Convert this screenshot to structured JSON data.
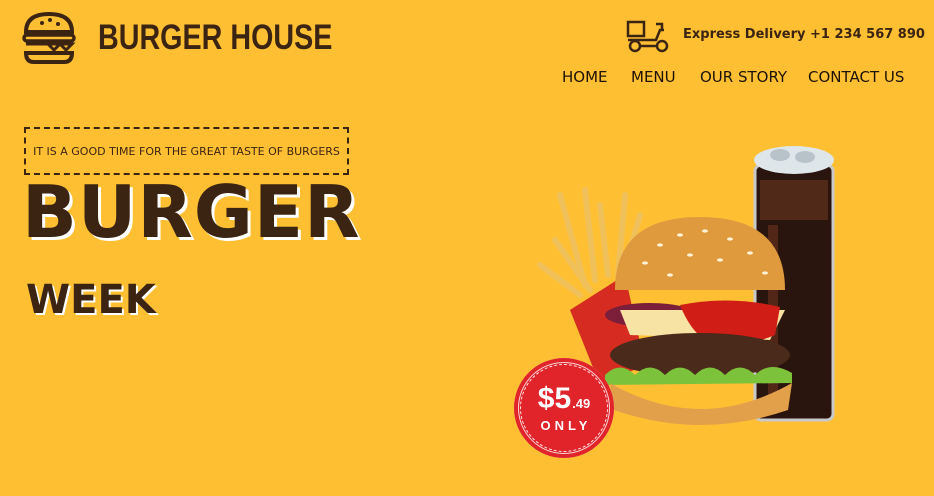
{
  "brand": {
    "name": "BURGER HOUSE",
    "logo_icon": "burger-icon"
  },
  "delivery": {
    "icon": "scooter-icon",
    "text": "Express Delivery +1 234 567 890"
  },
  "nav": {
    "items": [
      {
        "label": "HOME"
      },
      {
        "label": "MENU"
      },
      {
        "label": "OUR STORY"
      },
      {
        "label": "CONTACT US"
      }
    ]
  },
  "hero": {
    "tagline": "IT IS A GOOD TIME FOR THE GREAT TASTE OF BURGERS",
    "title": "BURGER",
    "subtitle": "WEEK"
  },
  "price": {
    "dollars": "$5",
    "cents": ".49",
    "note": "ONLY"
  },
  "colors": {
    "background": "#ffbf33",
    "brown": "#3b2412",
    "badge_red": "#e0242a"
  }
}
